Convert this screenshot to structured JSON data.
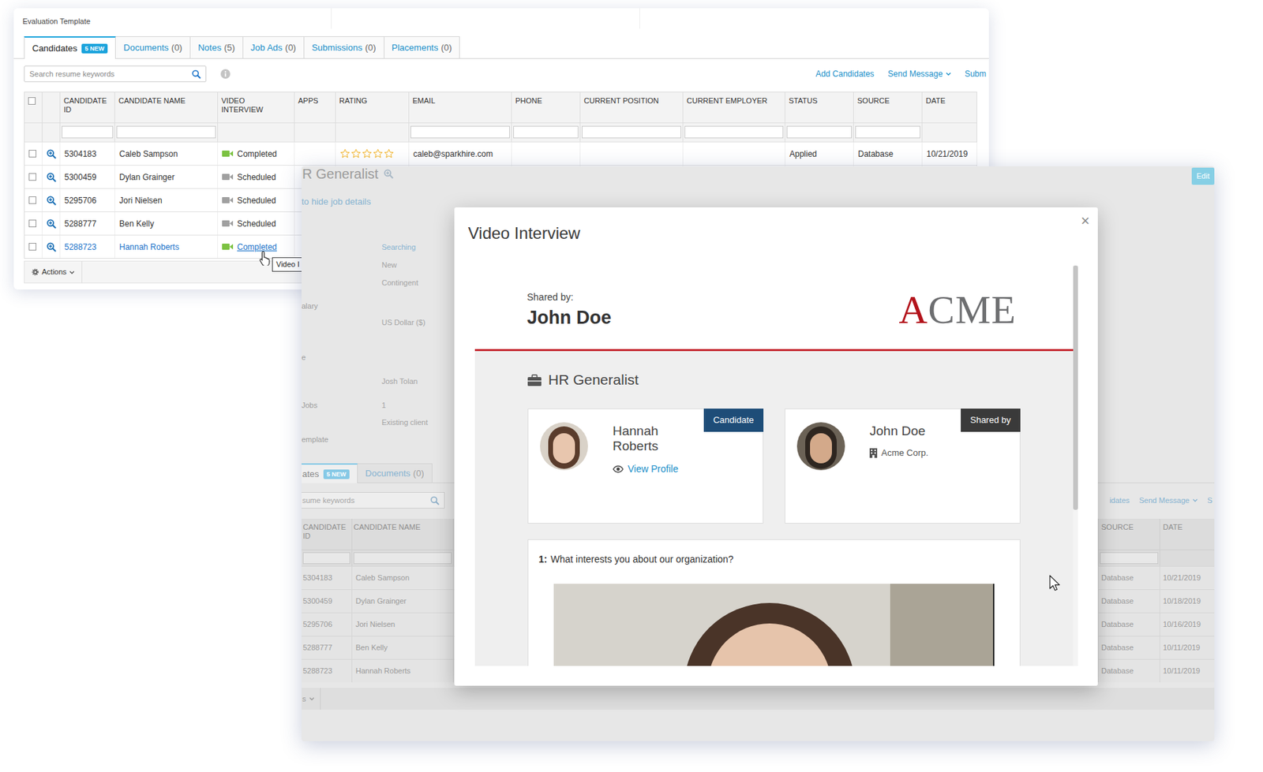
{
  "back_window": {
    "title": "Evaluation Template",
    "tabs": [
      {
        "label": "Candidates",
        "badge": "5 NEW",
        "selected": true
      },
      {
        "label": "Documents",
        "count": "(0)",
        "selected": false
      },
      {
        "label": "Notes",
        "count": "(5)",
        "selected": false
      },
      {
        "label": "Job Ads",
        "count": "(0)",
        "selected": false
      },
      {
        "label": "Submissions",
        "count": "(0)",
        "selected": false
      },
      {
        "label": "Placements",
        "count": "(0)",
        "selected": false
      }
    ],
    "search": {
      "placeholder": "Search resume keywords"
    },
    "toolbar": [
      {
        "label": "Add Candidates",
        "dropdown": false
      },
      {
        "label": "Send Message",
        "dropdown": true
      },
      {
        "label": "Subm",
        "dropdown": false
      }
    ],
    "table": {
      "select_all": {
        "checked": false
      },
      "columns": [
        "CANDIDATE ID",
        "CANDIDATE NAME",
        "VIDEO INTERVIEW",
        "APPS",
        "RATING",
        "EMAIL",
        "PHONE",
        "CURRENT POSITION",
        "CURRENT EMPLOYER",
        "STATUS",
        "SOURCE",
        "DATE"
      ],
      "rows": [
        {
          "checked": false,
          "hovered": false,
          "id": "5304183",
          "name": "Caleb Sampson",
          "video": {
            "label": "Completed",
            "color": "#7cc242"
          },
          "stars": 0,
          "email": "caleb@sparkhire.com",
          "status": "Applied",
          "source": "Database",
          "date": "10/21/2019"
        },
        {
          "checked": false,
          "hovered": false,
          "id": "5300459",
          "name": "Dylan Grainger",
          "video": {
            "label": "Scheduled",
            "color": "#a0a0a0"
          }
        },
        {
          "checked": false,
          "hovered": false,
          "id": "5295706",
          "name": "Jori Nielsen",
          "video": {
            "label": "Scheduled",
            "color": "#a0a0a0"
          }
        },
        {
          "checked": false,
          "hovered": false,
          "id": "5288777",
          "name": "Ben Kelly",
          "video": {
            "label": "Scheduled",
            "color": "#a0a0a0"
          }
        },
        {
          "checked": false,
          "hovered": true,
          "id": "5288723",
          "name": "Hannah Roberts",
          "video": {
            "label": "Completed",
            "color": "#7cc242"
          }
        }
      ]
    },
    "footer": {
      "label": "Actions",
      "dropdown": true
    }
  },
  "tooltip": {
    "text": "Video I"
  },
  "job_page": {
    "title": "R Generalist",
    "toggle_link": "to hide job details",
    "edit_button": "Edit",
    "fields": [
      {
        "value": "Searching",
        "link": true
      },
      {
        "value": "New",
        "link": false
      },
      {
        "value": "Contingent",
        "link": false
      },
      {
        "label": "alary",
        "link": false
      },
      {
        "value": "US Dollar ($)",
        "link": false
      },
      {
        "label": "e",
        "link": false
      },
      {
        "value": "Josh Tolan",
        "link": false
      },
      {
        "label": "Jobs",
        "value": "1",
        "link": false
      },
      {
        "value": "Existing client",
        "link": false
      },
      {
        "label": "emplate",
        "link": false
      }
    ],
    "tabs": [
      {
        "label": "ates",
        "badge": "5 NEW",
        "selected": true
      },
      {
        "label": "Documents",
        "count": "(0)",
        "selected": false
      }
    ],
    "search": {
      "placeholder": "sume keywords"
    },
    "toolbar": [
      {
        "label": "idates",
        "dropdown": false
      },
      {
        "label": "Send Message",
        "dropdown": true
      },
      {
        "label": "S",
        "dropdown": false
      }
    ],
    "table": {
      "left_columns": [
        "CANDIDATE ID",
        "CANDIDATE NAME"
      ],
      "right_columns": [
        "SOURCE",
        "DATE"
      ],
      "rows": [
        {
          "id": "5304183",
          "name": "Caleb Sampson",
          "source": "Database",
          "date": "10/21/2019"
        },
        {
          "id": "5300459",
          "name": "Dylan Grainger",
          "source": "Database",
          "date": "10/18/2019"
        },
        {
          "id": "5295706",
          "name": "Jori Nielsen",
          "source": "Database",
          "date": "10/16/2019"
        },
        {
          "id": "5288777",
          "name": "Ben Kelly",
          "source": "Database",
          "date": "10/11/2019"
        },
        {
          "id": "5288723",
          "name": "Hannah Roberts",
          "source": "Database",
          "date": "10/11/2019"
        }
      ]
    },
    "footer": {
      "label": "s",
      "dropdown": true
    }
  },
  "modal": {
    "title": "Video Interview",
    "close": "×",
    "shared_by_label": "Shared by:",
    "shared_by_name": "John Doe",
    "logo": [
      {
        "text": "A",
        "color": "#b3131b"
      },
      {
        "text": "CME",
        "color": "#6d6e70"
      }
    ],
    "job_title": "HR Generalist",
    "cards": [
      {
        "kind": "candidate",
        "name": "Hannah Roberts",
        "badge": "Candidate",
        "color": "#1e4d78",
        "link": "View Profile"
      },
      {
        "kind": "sharer",
        "name": "John Doe",
        "badge": "Shared by",
        "color": "#3a3a3a",
        "company": "Acme Corp."
      }
    ],
    "questions": [
      {
        "number": "1:",
        "text": "What interests you about our organization?"
      }
    ],
    "scrollbar": {
      "level": 0.61
    }
  }
}
